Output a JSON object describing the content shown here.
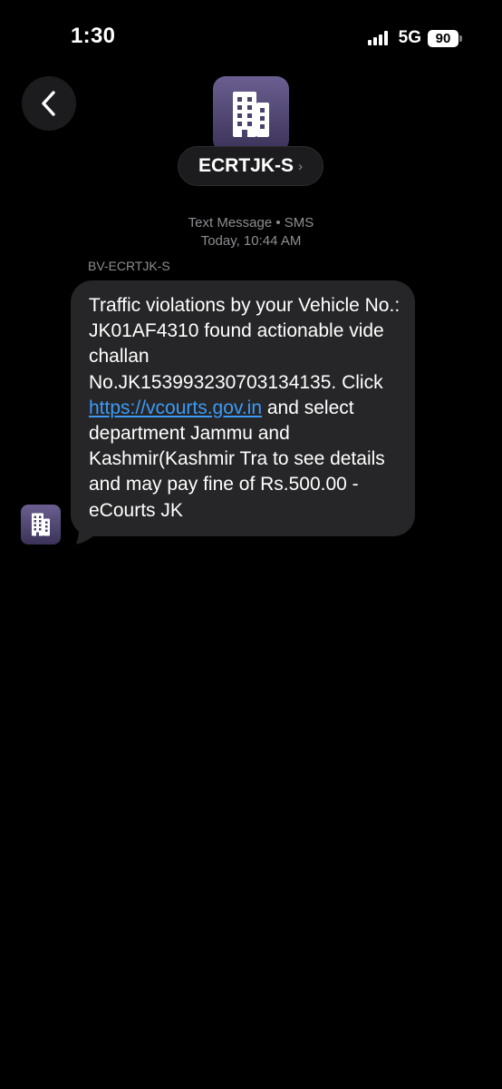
{
  "status_bar": {
    "time": "1:30",
    "network": "5G",
    "battery": "90"
  },
  "header": {
    "contact_name": "ECRTJK-S",
    "chevron": "›",
    "back_icon": "chevron-left-icon",
    "avatar_icon": "building-icon"
  },
  "message_meta": {
    "service": "Text Message • SMS",
    "timestamp": "Today, 10:44 AM",
    "sender_label": "BV-ECRTJK-S"
  },
  "message": {
    "text_before_link": "Traffic violations by your Vehicle No.: JK01AF4310 found actionable vide challan No.JK153993230703134135. Click ",
    "link": "https://vcourts.gov.in",
    "text_after_link": " and select department Jammu and Kashmir(Kashmir Tra to see details and may pay fine of Rs.500.00 -eCourts JK"
  },
  "colors": {
    "background": "#000000",
    "bubble": "#262628",
    "link": "#3b9bf7",
    "secondary_text": "#8e8e93",
    "avatar": "#4d4470"
  }
}
